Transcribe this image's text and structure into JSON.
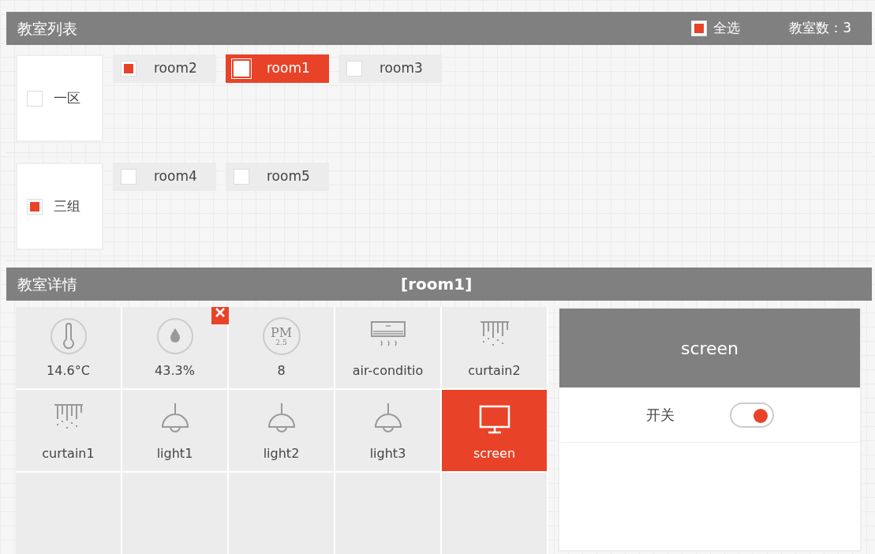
{
  "room_list": {
    "title": "教室列表",
    "select_all": {
      "label": "全选",
      "checked": true
    },
    "count": "教室数：3"
  },
  "groups": [
    {
      "name": "一区",
      "checked": false,
      "rooms": [
        {
          "name": "room2",
          "checked": true,
          "selected": false
        },
        {
          "name": "room1",
          "checked": false,
          "selected": true
        },
        {
          "name": "room3",
          "checked": false,
          "selected": false
        }
      ]
    },
    {
      "name": "三组",
      "checked": true,
      "rooms": [
        {
          "name": "room4",
          "checked": false,
          "selected": false
        },
        {
          "name": "room5",
          "checked": false,
          "selected": false
        }
      ]
    }
  ],
  "detail": {
    "title": "教室详情",
    "room": "[room1]"
  },
  "devices": [
    {
      "kind": "temperature",
      "label": "14.6°C",
      "selected": false,
      "alert": false
    },
    {
      "kind": "humidity",
      "label": "43.3%",
      "selected": false,
      "alert": true
    },
    {
      "kind": "pm",
      "label": "8",
      "icon_text": "PM",
      "icon_subtext": "2.5",
      "selected": false,
      "alert": false
    },
    {
      "kind": "aircon",
      "label": "air-conditio",
      "selected": false,
      "alert": false
    },
    {
      "kind": "curtain",
      "label": "curtain2",
      "selected": false,
      "alert": false
    },
    {
      "kind": "curtain",
      "label": "curtain1",
      "selected": false,
      "alert": false
    },
    {
      "kind": "light",
      "label": "light1",
      "selected": false,
      "alert": false
    },
    {
      "kind": "light",
      "label": "light2",
      "selected": false,
      "alert": false
    },
    {
      "kind": "light",
      "label": "light3",
      "selected": false,
      "alert": false
    },
    {
      "kind": "screen",
      "label": "screen",
      "selected": true,
      "alert": false
    }
  ],
  "panel": {
    "title": "screen",
    "controls": [
      {
        "label": "开关",
        "on": true
      }
    ]
  }
}
